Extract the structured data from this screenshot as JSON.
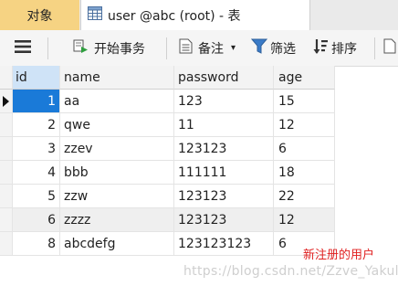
{
  "tabs": {
    "objects_label": "对象",
    "table_label": "user @abc (root) - 表"
  },
  "toolbar": {
    "begin_transaction": "开始事务",
    "note": "备注",
    "filter": "筛选",
    "sort": "排序"
  },
  "grid": {
    "columns": [
      "id",
      "name",
      "password",
      "age"
    ],
    "rows": [
      {
        "id": "1",
        "name": "aa",
        "password": "123",
        "age": "15"
      },
      {
        "id": "2",
        "name": "qwe",
        "password": "11",
        "age": "12"
      },
      {
        "id": "3",
        "name": "zzev",
        "password": "123123",
        "age": "6"
      },
      {
        "id": "4",
        "name": "bbb",
        "password": "111111",
        "age": "18"
      },
      {
        "id": "5",
        "name": "zzw",
        "password": "123123",
        "age": "22"
      },
      {
        "id": "6",
        "name": "zzzz",
        "password": "123123",
        "age": "12"
      },
      {
        "id": "8",
        "name": "abcdefg",
        "password": "123123123",
        "age": "6"
      }
    ]
  },
  "annotation": "新注册的用户",
  "watermark": "https://blog.csdn.net/Zzve_Yakul",
  "colors": {
    "objects_tab": "#f6d383",
    "selected_cell": "#1a7ad8",
    "annotation": "#e02020"
  }
}
